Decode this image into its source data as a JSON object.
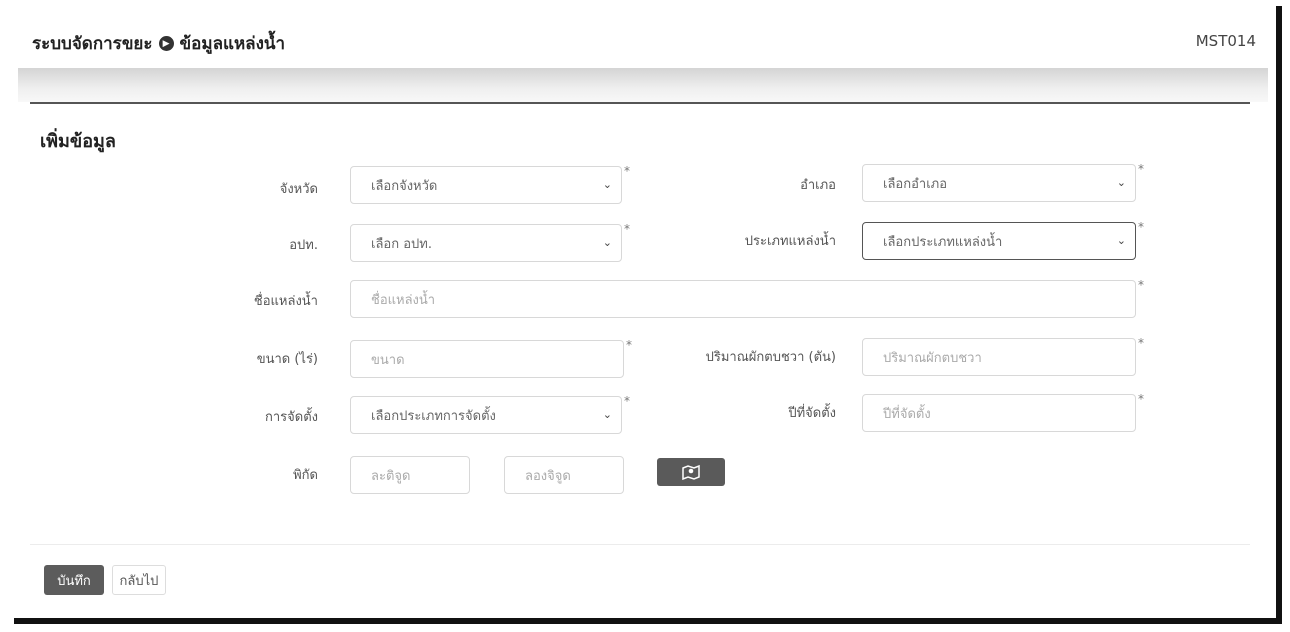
{
  "header": {
    "breadcrumb_root": "ระบบจัดการขยะ",
    "breadcrumb_page": "ข้อมูลแหล่งน้ำ",
    "page_code": "MST014"
  },
  "form": {
    "title": "เพิ่มข้อมูล",
    "province": {
      "label": "จังหวัด",
      "value": "เลือกจังหวัด"
    },
    "district": {
      "label": "อำเภอ",
      "value": "เลือกอำเภอ"
    },
    "lao": {
      "label": "อปท.",
      "value": "เลือก อปท."
    },
    "water_type": {
      "label": "ประเภทแหล่งน้ำ",
      "value": "เลือกประเภทแหล่งน้ำ"
    },
    "water_name": {
      "label": "ชื่อแหล่งน้ำ",
      "placeholder": "ชื่อแหล่งน้ำ"
    },
    "size": {
      "label": "ขนาด (ไร่)",
      "placeholder": "ขนาด"
    },
    "hyacinth": {
      "label": "ปริมาณผักตบชวา (ตัน)",
      "placeholder": "ปริมาณผักตบชวา"
    },
    "management": {
      "label": "การจัดตั้ง",
      "value": "เลือกประเภทการจัดตั้ง"
    },
    "year": {
      "label": "ปีที่จัดตั้ง",
      "placeholder": "ปีที่จัดตั้ง"
    },
    "coords": {
      "label": "พิกัด",
      "lat_placeholder": "ละติจูด",
      "lng_placeholder": "ลองจิจูด"
    },
    "required_mark": "*"
  },
  "buttons": {
    "save": "บันทึก",
    "back": "กลับไป"
  }
}
